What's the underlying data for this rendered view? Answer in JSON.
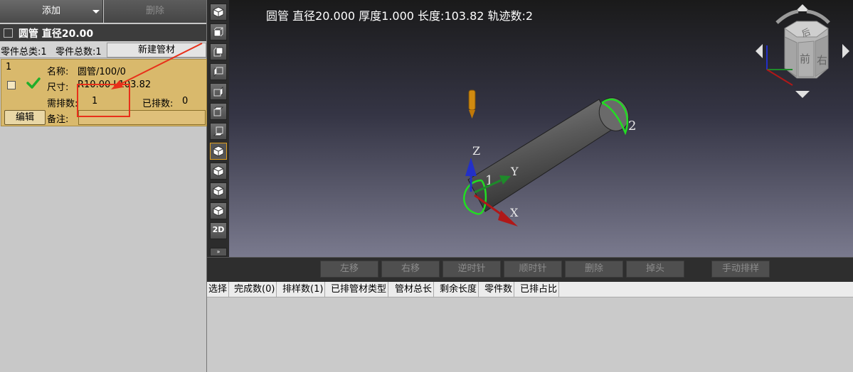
{
  "left_panel": {
    "add_label": "添加",
    "delete_label": "删除",
    "group_title": "圆管 直径20.00",
    "category_total": "零件总类:1",
    "part_total": "零件总数:1",
    "new_tube_label": "新建管材",
    "part": {
      "index": "1",
      "name_label": "名称:",
      "name_value": "圆管/100/0",
      "size_label": "尺寸:",
      "size_value": "R10.00 L103.82",
      "required_label": "需排数:",
      "required_value": "1",
      "nested_label": "已排数:",
      "nested_value": "0",
      "remark_label": "备注:",
      "remark_value": "",
      "edit_label": "编辑"
    }
  },
  "viewport": {
    "info": "圆管 直径20.000 厚度1.000 长度:103.82 轨迹数:2",
    "axis_labels": {
      "x": "X",
      "y": "Y",
      "z": "Z"
    },
    "path_labels": [
      "1",
      "2"
    ],
    "viewcube_faces": {
      "top": "后",
      "front": "前",
      "right": "右"
    }
  },
  "actions": [
    "左移",
    "右移",
    "逆时针",
    "顺时针",
    "删除",
    "掉头",
    "手动排样"
  ],
  "table": {
    "columns": [
      "选择",
      "完成数(0)",
      "排样数(1)",
      "已排管材类型",
      "管材总长",
      "剩余长度",
      "零件数",
      "已排占比"
    ]
  },
  "toolbar": {
    "items": [
      "view-iso-icon",
      "view-front-icon",
      "view-back-icon",
      "view-left-icon",
      "view-right-icon",
      "view-top-icon",
      "view-bottom-icon",
      "view-shaded-icon",
      "view-wire-icon",
      "view-hidden-icon",
      "view-edges-icon"
    ],
    "mode_2d": "2D"
  },
  "colors": {
    "accent": "#d9b96c",
    "annotation": "#e8301a",
    "path": "#22dd22"
  }
}
